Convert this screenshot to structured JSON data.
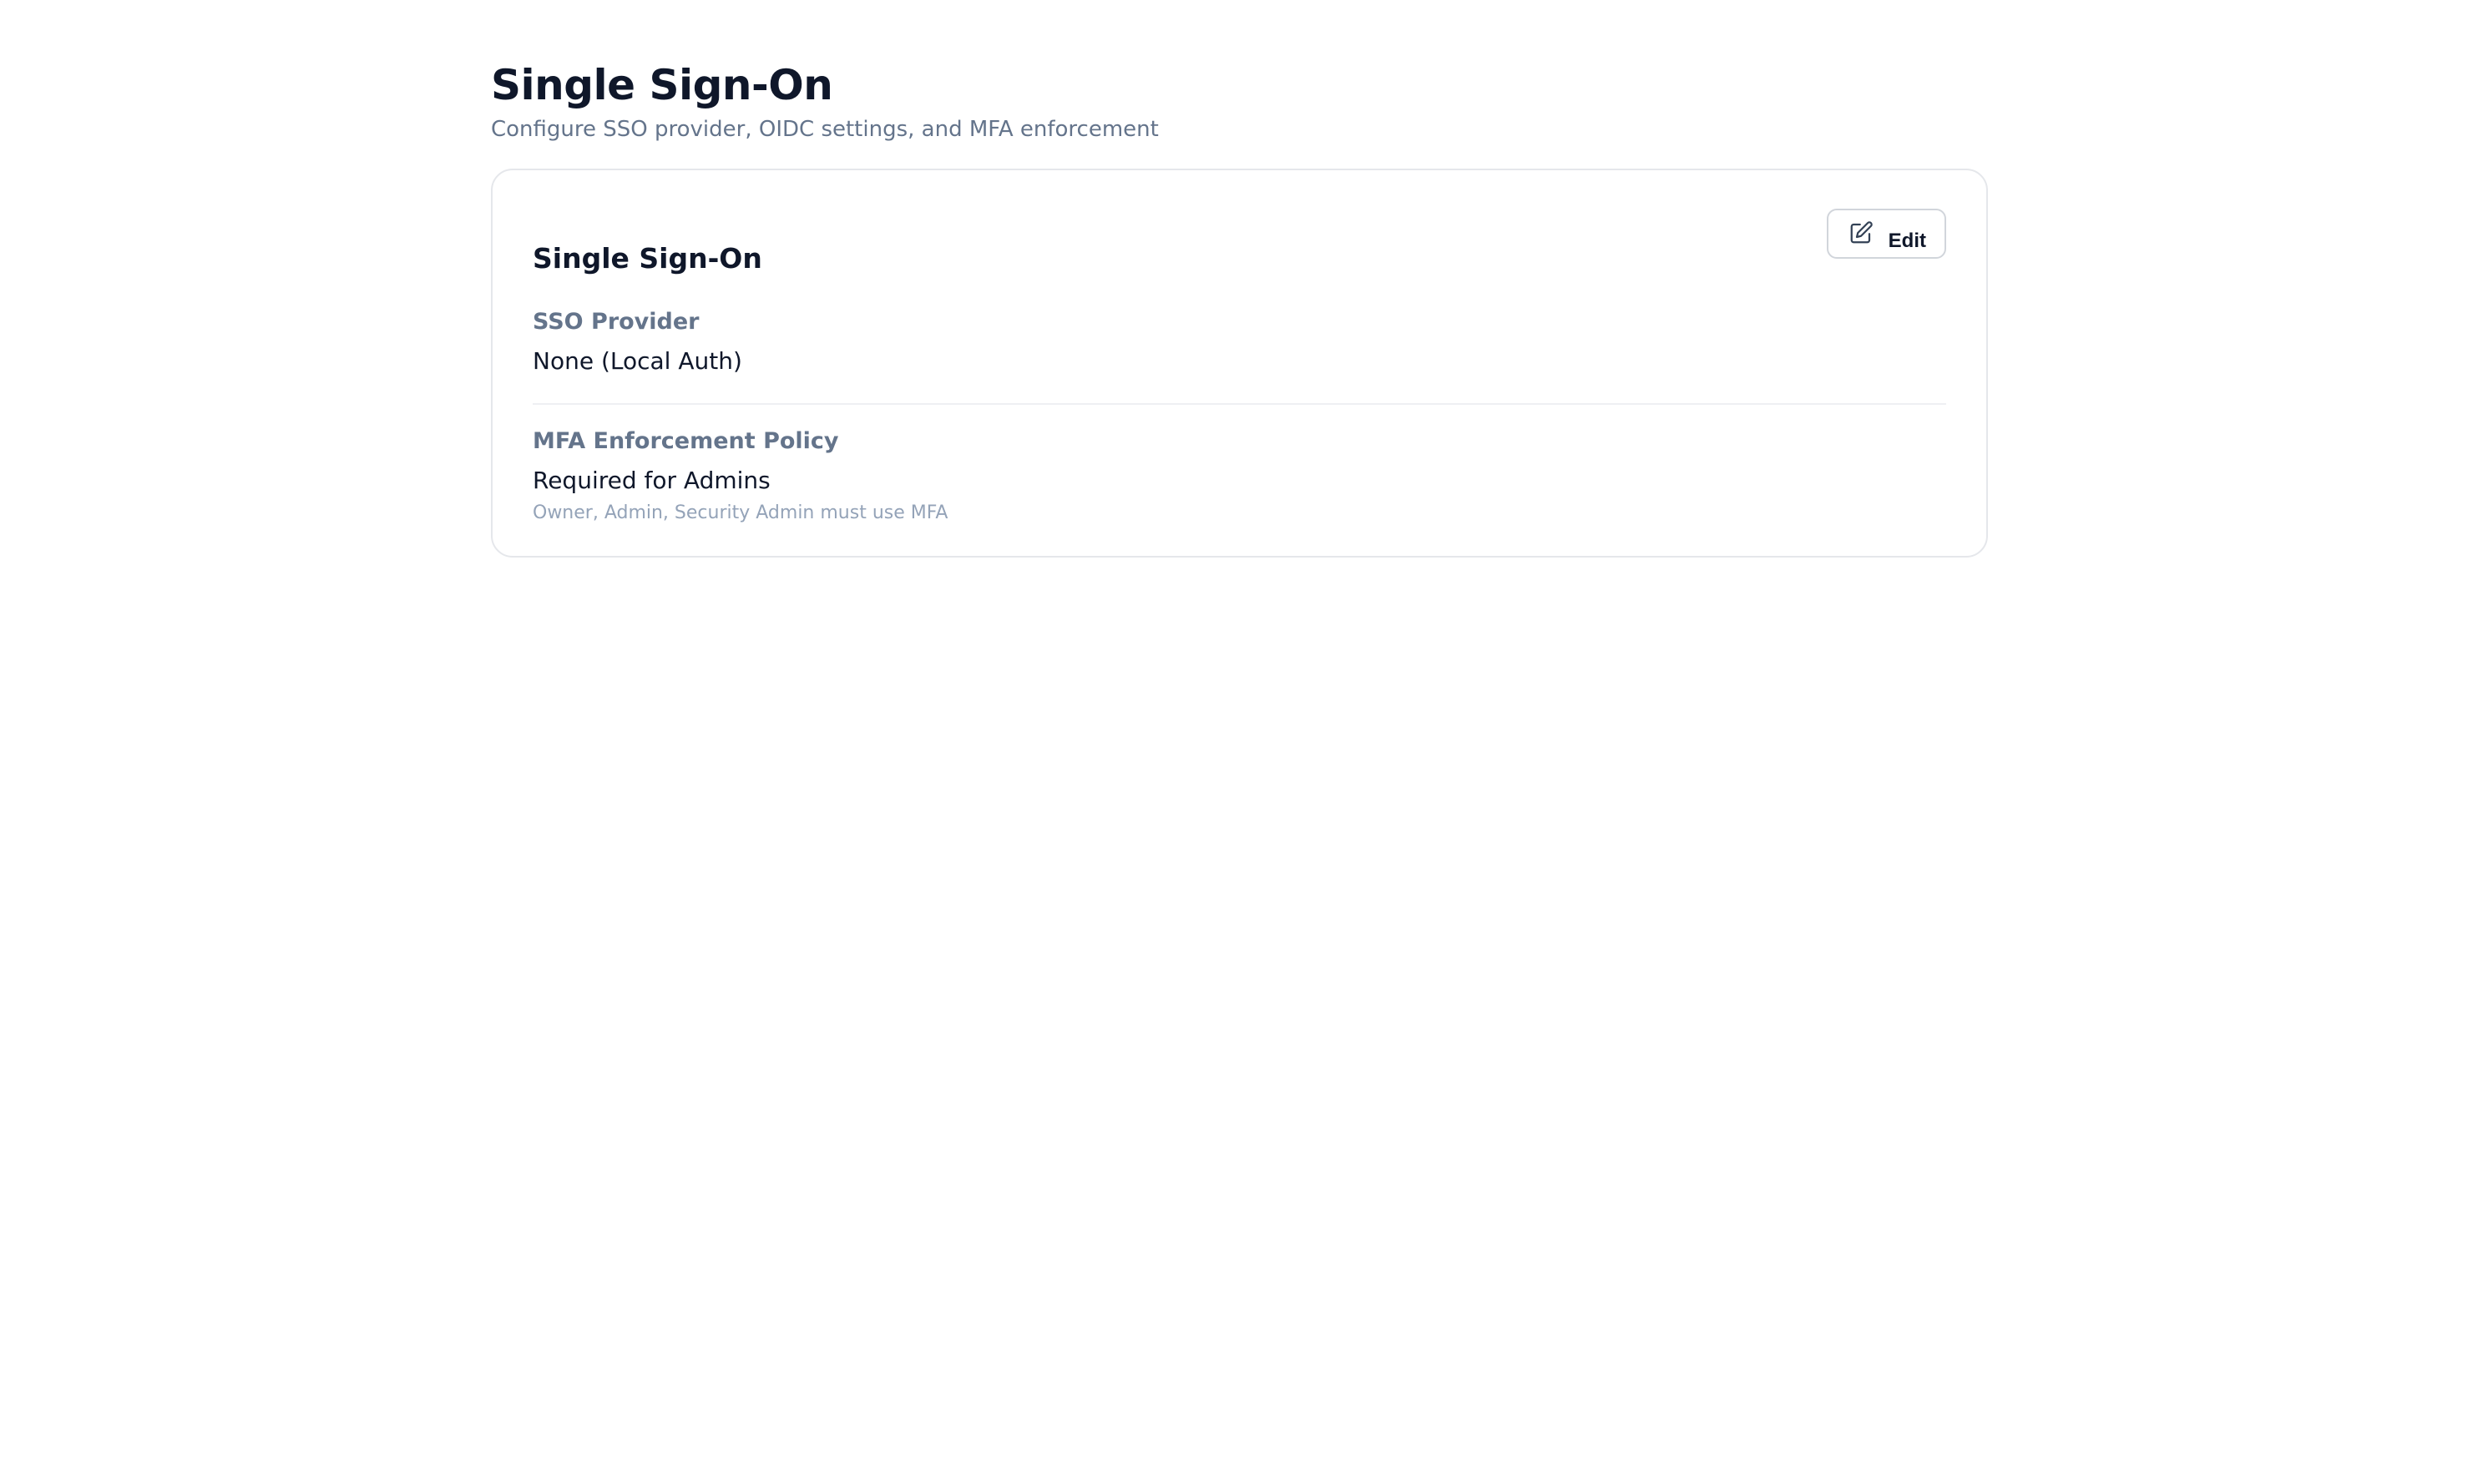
{
  "page": {
    "title": "Single Sign-On",
    "subtitle": "Configure SSO provider, OIDC settings, and MFA enforcement"
  },
  "card": {
    "title": "Single Sign-On",
    "edit_label": "Edit",
    "edit_icon": "pencil-square-icon",
    "fields": [
      {
        "label": "SSO Provider",
        "value": "None (Local Auth)"
      },
      {
        "label": "MFA Enforcement Policy",
        "value": "Required for Admins",
        "help": "Owner, Admin, Security Admin must use MFA"
      }
    ]
  }
}
